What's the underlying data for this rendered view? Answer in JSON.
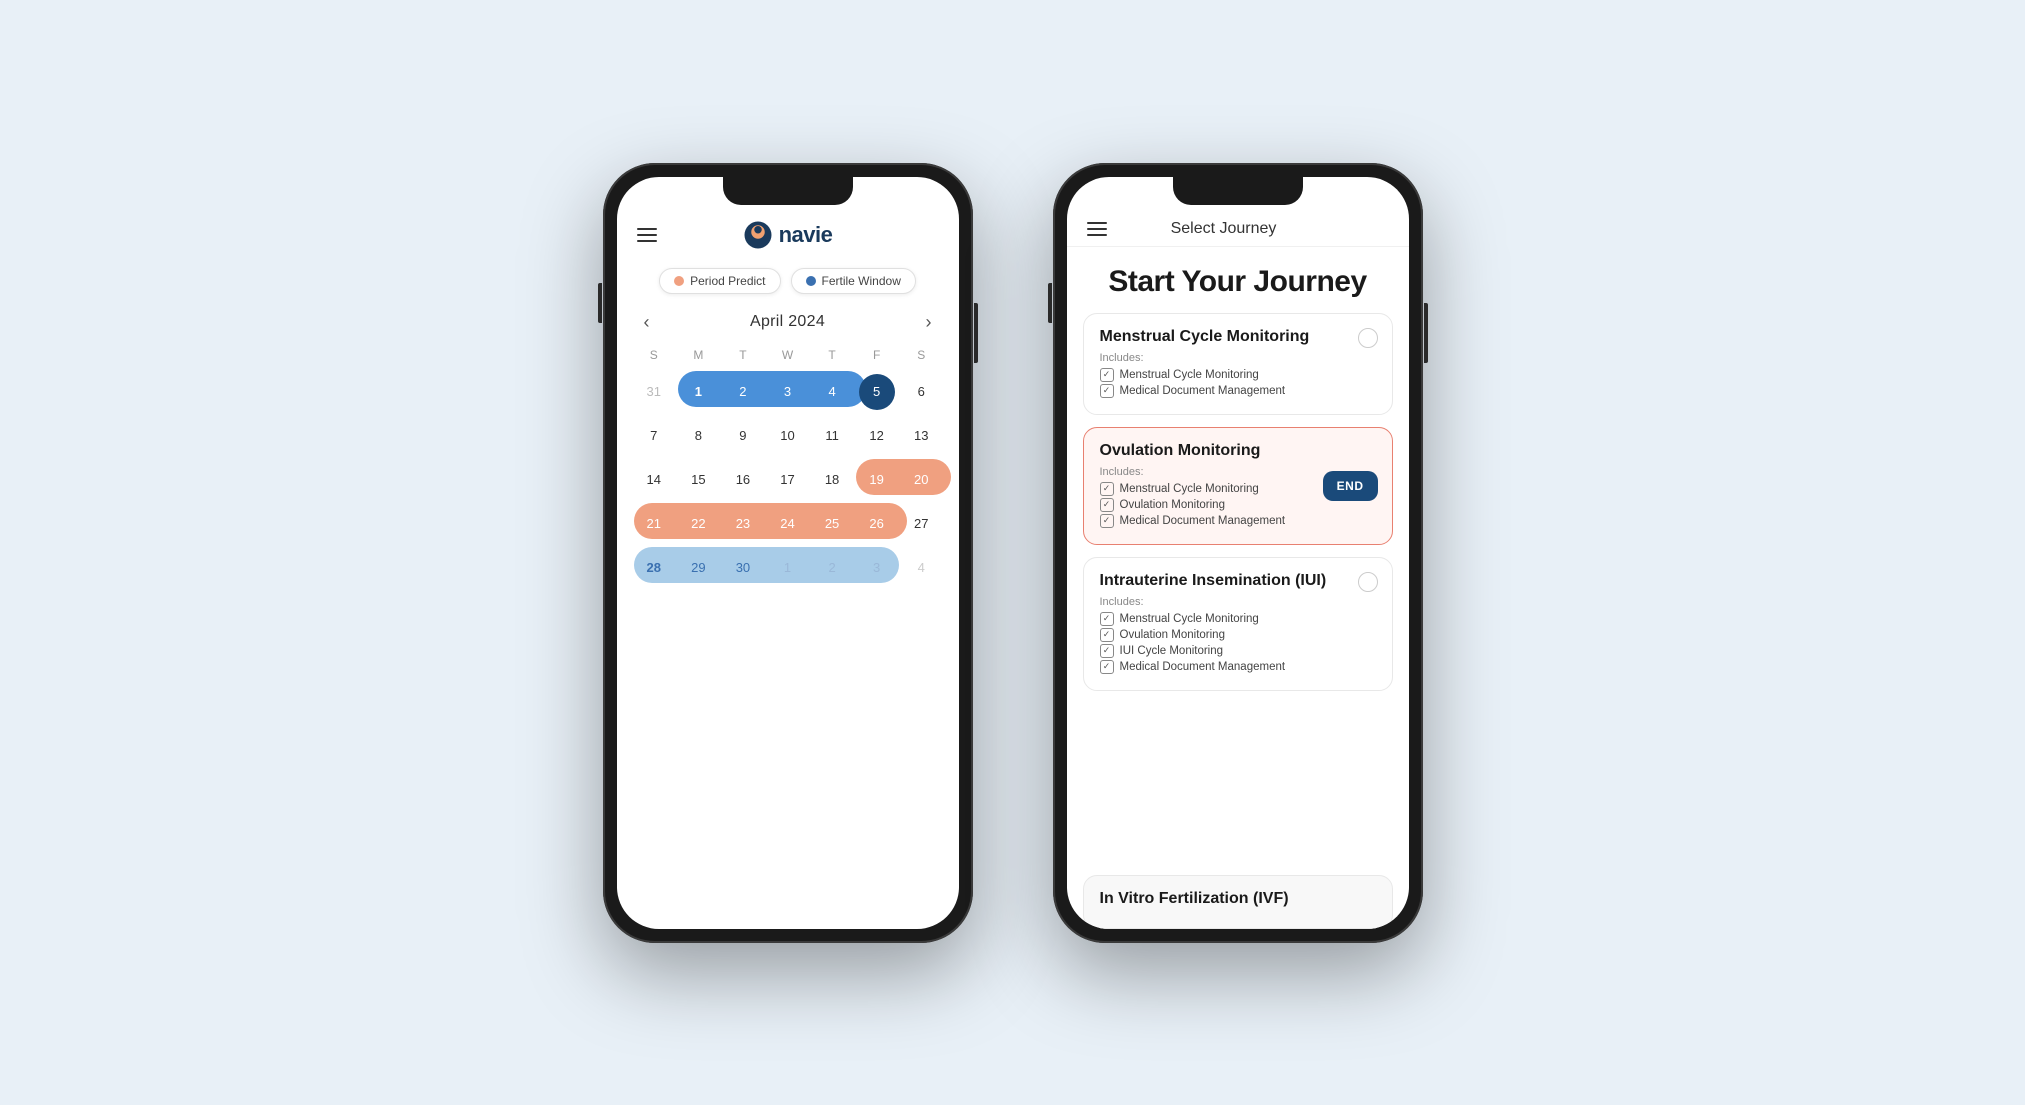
{
  "phone1": {
    "logo_text": "navie",
    "hamburger_label": "Menu",
    "legend": [
      {
        "label": "Period Predict",
        "color": "#f0a080"
      },
      {
        "label": "Fertile Window",
        "color": "#3a70b0"
      }
    ],
    "calendar": {
      "month": "April  2024",
      "weekdays": [
        "S",
        "M",
        "T",
        "W",
        "T",
        "F",
        "S"
      ],
      "weeks": [
        [
          "31",
          "1",
          "2",
          "3",
          "4",
          "5",
          "6"
        ],
        [
          "7",
          "8",
          "9",
          "10",
          "11",
          "12",
          "13"
        ],
        [
          "14",
          "15",
          "16",
          "17",
          "18",
          "19",
          "20"
        ],
        [
          "21",
          "22",
          "23",
          "24",
          "25",
          "26",
          "27"
        ],
        [
          "28",
          "29",
          "30",
          "1",
          "2",
          "3",
          "4"
        ]
      ]
    }
  },
  "phone2": {
    "header_title": "Select Journey",
    "main_title": "Start Your Journey",
    "hamburger_label": "Menu",
    "journeys": [
      {
        "title": "Menstrual Cycle Monitoring",
        "includes_label": "Includes:",
        "items": [
          "Menstrual Cycle Monitoring",
          "Medical Document Management"
        ],
        "selected": false,
        "has_end": false
      },
      {
        "title": "Ovulation Monitoring",
        "includes_label": "Includes:",
        "items": [
          "Menstrual Cycle Monitoring",
          "Ovulation Monitoring",
          "Medical Document Management"
        ],
        "selected": true,
        "has_end": true,
        "end_label": "END"
      },
      {
        "title": "Intrauterine Insemination (IUI)",
        "includes_label": "Includes:",
        "items": [
          "Menstrual Cycle Monitoring",
          "Ovulation Monitoring",
          "IUI Cycle Monitoring",
          "Medical Document Management"
        ],
        "selected": false,
        "has_end": false
      }
    ],
    "ivf_title": "In Vitro Fertilization (IVF)"
  }
}
